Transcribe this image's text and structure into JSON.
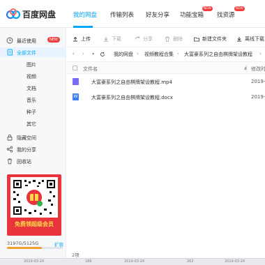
{
  "app": {
    "title": "百度网盘"
  },
  "nav": {
    "items": [
      {
        "label": "我的网盘",
        "active": true
      },
      {
        "label": "传输列表"
      },
      {
        "label": "好友分享"
      },
      {
        "label": "功能宝箱",
        "badge": "NEW"
      },
      {
        "label": "找资源",
        "badge": "NEW"
      }
    ]
  },
  "sidebar": {
    "recent": {
      "label": "最近使用",
      "badge": "NEW"
    },
    "all_files": {
      "label": "全部文件"
    },
    "categories": [
      "图片",
      "视频",
      "文档",
      "音乐",
      "种子",
      "其它"
    ],
    "hidden_space": {
      "label": "隐藏空间"
    },
    "my_share": {
      "label": "我的分享"
    },
    "recycle": {
      "label": "回收站"
    },
    "ad": {
      "text": "免费领超级会员"
    },
    "storage": {
      "text": "3197G/5125G",
      "expand": "扩容",
      "used_fraction": 0.62
    }
  },
  "toolbar": {
    "upload": "上传",
    "download": "下载",
    "share": "分享",
    "delete": "删除",
    "new_folder": "新建文件夹",
    "offline": "离线下载"
  },
  "path": {
    "segments": [
      "我的网盘",
      "视频教程合集",
      "大富豪系列之自由棋牌架设教程"
    ]
  },
  "table": {
    "columns": {
      "name": "文件名",
      "modified": "修改时"
    },
    "rows": [
      {
        "name": "大富豪系列之自由棋牌架设教程.mp4",
        "modified": "2019-0",
        "type": "video"
      },
      {
        "name": "大富豪系列之自由棋牌架设教程.docx",
        "modified": "2019-0",
        "type": "word"
      }
    ]
  },
  "status": {
    "count": "2项"
  },
  "bottom_strip": {
    "items": [
      "2019-03-24",
      "186",
      "2019-03-24",
      "262",
      "2019-03-24"
    ]
  },
  "colors": {
    "accent": "#06a7ff",
    "badge": "#f43d3d",
    "ad_bg": "#e9333d",
    "storage": "#f0a030"
  }
}
